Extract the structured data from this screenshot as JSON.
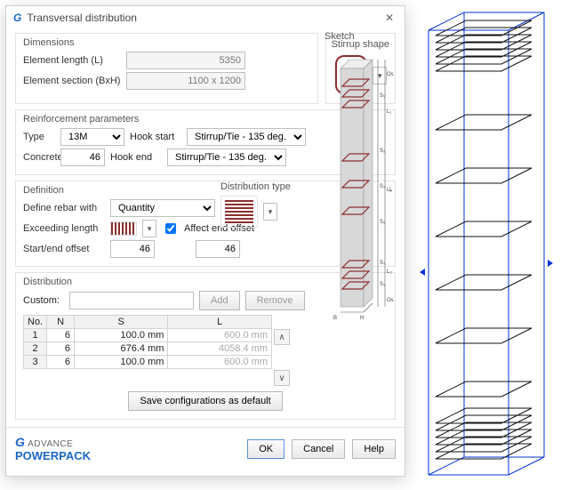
{
  "window": {
    "title": "Transversal distribution"
  },
  "dimensions": {
    "title": "Dimensions",
    "len_lbl": "Element length (L)",
    "len_val": "5350",
    "sec_lbl": "Element section (BxH)",
    "sec_val": "1100 x 1200"
  },
  "stirrup": {
    "title": "Stirrup shape"
  },
  "sketch": {
    "title": "Sketch"
  },
  "reinf": {
    "title": "Reinforcement parameters",
    "type_lbl": "Type",
    "type_val": "13M",
    "hookstart_lbl": "Hook start",
    "hookstart_val": "Stirrup/Tie - 135 deg.",
    "cover_lbl": "Concrete cover",
    "cover_val": "46",
    "hookend_lbl": "Hook end",
    "hookend_val": "Stirrup/Tie - 135 deg."
  },
  "def": {
    "title": "Definition",
    "define_lbl": "Define rebar with",
    "define_val": "Quantity",
    "exceed_lbl": "Exceeding length",
    "affect_lbl": "Affect end offset",
    "startend_lbl": "Start/end offset",
    "start_val": "46",
    "end_val": "46",
    "dist_type_title": "Distribution type"
  },
  "dist": {
    "title": "Distribution",
    "custom_lbl": "Custom:",
    "add_lbl": "Add",
    "remove_lbl": "Remove",
    "cols": {
      "no": "No.",
      "n": "N",
      "s": "S",
      "l": "L"
    },
    "rows": [
      {
        "no": "1",
        "n": "6",
        "s": "100.0 mm",
        "l": "600.0 mm"
      },
      {
        "no": "2",
        "n": "6",
        "s": "676.4 mm",
        "l": "4058.4 mm"
      },
      {
        "no": "3",
        "n": "6",
        "s": "100.0 mm",
        "l": "600.0 mm"
      }
    ],
    "save_lbl": "Save configurations as default"
  },
  "footer": {
    "brand_small": "ADVANCE",
    "brand_big": "POWERPACK",
    "ok": "OK",
    "cancel": "Cancel",
    "help": "Help"
  }
}
